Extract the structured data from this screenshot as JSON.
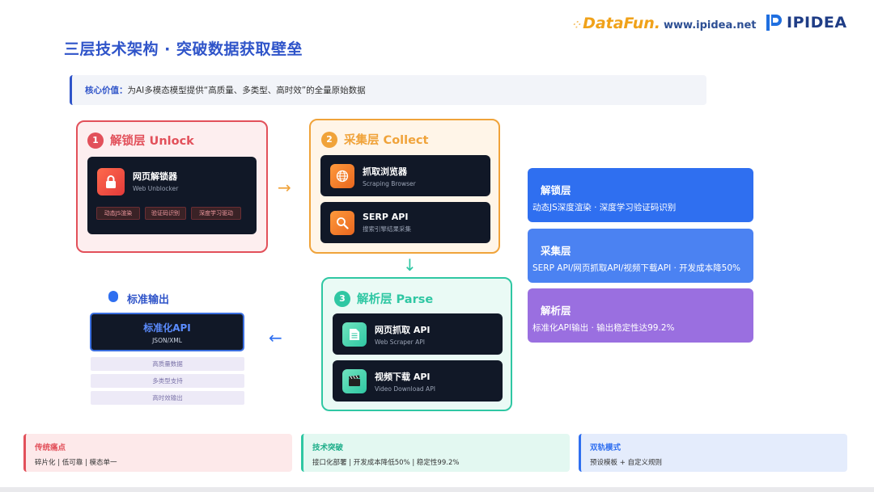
{
  "header": {
    "title": "三层技术架构 · 突破数据获取壁垒",
    "datafun_logo": "DataFun.",
    "url": "www.ipidea.net",
    "ipidea_logo": "IPIDEA"
  },
  "core_value": {
    "key": "核心价值：",
    "text": "为AI多模态模型提供“高质量、多类型、高时效”的全量原始数据"
  },
  "layers": {
    "unlock": {
      "num": "1",
      "name": "解锁层 Unlock",
      "color": "#e2505a",
      "card": {
        "title": "网页解锁器",
        "sub": "Web Unblocker",
        "icon": "lock-icon"
      },
      "tags": [
        "动态JS渲染",
        "验证码识别",
        "深度学习驱动"
      ]
    },
    "collect": {
      "num": "2",
      "name": "采集层 Collect",
      "color": "#f0a33a",
      "cards": [
        {
          "title": "抓取浏览器",
          "sub": "Scraping Browser",
          "icon": "globe-icon"
        },
        {
          "title": "SERP API",
          "sub": "搜索引擎结果采集",
          "icon": "search-icon"
        }
      ]
    },
    "parse": {
      "num": "3",
      "name": "解析层 Parse",
      "color": "#2fc7a3",
      "cards": [
        {
          "title": "网页抓取 API",
          "sub": "Web Scraper API",
          "icon": "document-icon"
        },
        {
          "title": "视频下载 API",
          "sub": "Video Download API",
          "icon": "clapperboard-icon"
        }
      ]
    }
  },
  "standard_output": {
    "title": "标准输出",
    "api_title": "标准化API",
    "api_sub": "JSON/XML",
    "features": [
      "高质量数据",
      "多类型支持",
      "高时效输出"
    ]
  },
  "right_panels": [
    {
      "title": "解锁层",
      "desc": "动态JS深度渲染 · 深度学习验证码识别",
      "color": "#2f6ff0"
    },
    {
      "title": "采集层",
      "desc": "SERP API/网页抓取API/视频下载API · 开发成本降50%",
      "color": "#4b82f2"
    },
    {
      "title": "解析层",
      "desc": "标准化API输出 · 输出稳定性达99.2%",
      "color": "#9a6fe0"
    }
  ],
  "bottom_cards": [
    {
      "title": "传统痛点",
      "desc": "碎片化 | 低可靠 | 模态单一",
      "color": "#e2505a"
    },
    {
      "title": "技术突破",
      "desc": "接口化部署 | 开发成本降低50% | 稳定性99.2%",
      "color": "#2fc7a3"
    },
    {
      "title": "双轨模式",
      "desc": "预设模板 + 自定义规则",
      "color": "#2f6ff0"
    }
  ],
  "arrows": {
    "right": "→",
    "down": "↓",
    "left": "←"
  }
}
